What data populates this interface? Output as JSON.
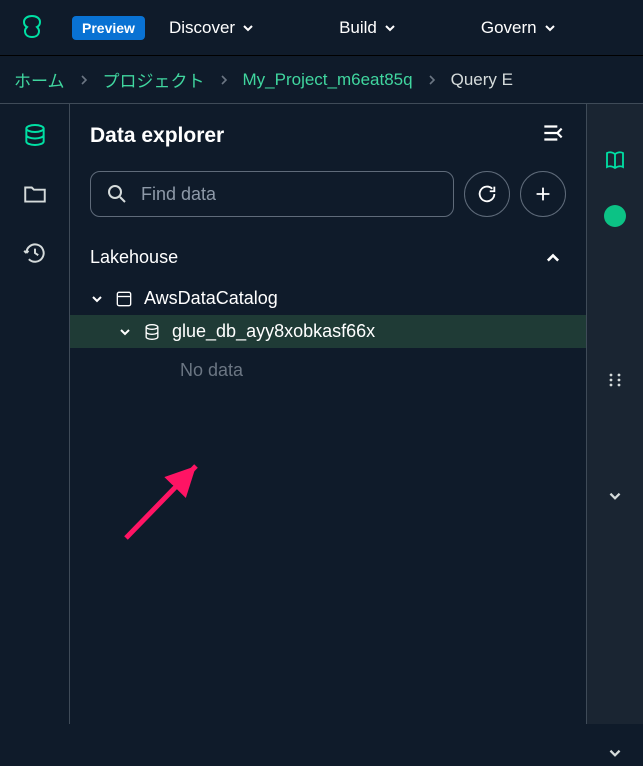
{
  "topbar": {
    "preview_label": "Preview",
    "nav": {
      "discover": "Discover",
      "build": "Build",
      "govern": "Govern"
    }
  },
  "breadcrumb": {
    "home": "ホーム",
    "project": "プロジェクト",
    "my_project": "My_Project_m6eat85q",
    "last": "Query E"
  },
  "panel": {
    "title": "Data explorer"
  },
  "search": {
    "placeholder": "Find data"
  },
  "section": {
    "lakehouse": "Lakehouse"
  },
  "tree": {
    "catalog": "AwsDataCatalog",
    "database": "glue_db_ayy8xobkasf66x",
    "empty": "No data"
  }
}
